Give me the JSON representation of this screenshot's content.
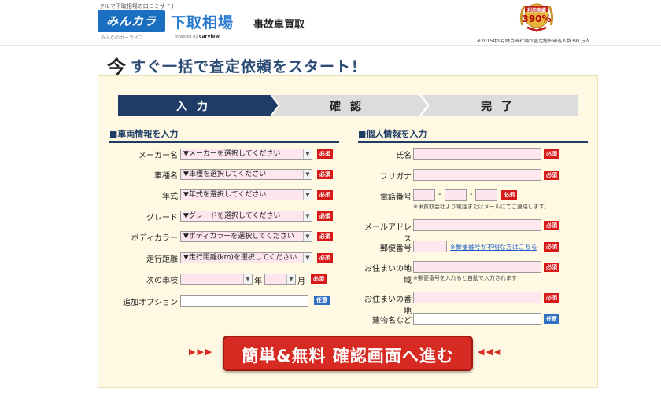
{
  "header": {
    "tagline": "クルマ下取相場の口コミサイト",
    "logo": "みんカラ",
    "logo_sub": "みんなのカーライフ",
    "powered": "powered by",
    "powered_brand": "carview",
    "brand": "下取相場",
    "service": "事故車買取",
    "medal_label": "利用実績",
    "medal_value": "390%",
    "stat_note": "※2015年9月時点当社調べ査定総お申込人数391万人"
  },
  "headline": {
    "icon": "今",
    "text": "すぐ一括で査定依頼をスタート！"
  },
  "steps": {
    "step1": "入力",
    "step2": "確認",
    "step3": "完了"
  },
  "car_section": {
    "title": "■車両情報を入力",
    "fields": {
      "maker": {
        "label": "メーカー名",
        "value": "▼メーカーを選択してください",
        "required": "必須"
      },
      "model": {
        "label": "車種名",
        "value": "▼車種を選択してください",
        "required": "必須"
      },
      "year": {
        "label": "年式",
        "value": "▼年式を選択してください",
        "required": "必須"
      },
      "grade": {
        "label": "グレード",
        "value": "▼グレードを選択してください",
        "required": "必須"
      },
      "color": {
        "label": "ボディカラー",
        "value": "▼ボディカラーを選択してください",
        "required": "必須"
      },
      "mileage": {
        "label": "走行距離",
        "value": "▼走行距離(km)を選択してください",
        "required": "必須"
      },
      "inspection": {
        "label": "次の車検",
        "year_unit": "年",
        "month_unit": "月",
        "required": "必須"
      },
      "options": {
        "label": "追加オプション",
        "optional": "任意"
      }
    }
  },
  "person_section": {
    "title": "■個人情報を入力",
    "fields": {
      "name": {
        "label": "氏名",
        "required": "必須"
      },
      "kana": {
        "label": "フリガナ",
        "required": "必須"
      },
      "phone": {
        "label": "電話番号",
        "sep": "-",
        "required": "必須",
        "note": "※車買取会社より電話またはメールにてご連絡します。"
      },
      "email": {
        "label": "メールアドレス",
        "required": "必須"
      },
      "zip": {
        "label": "郵便番号",
        "link": "※郵便番号が不明な方はこちら",
        "required": "必須"
      },
      "region": {
        "label": "お住まいの地域",
        "required": "必須",
        "note": "※郵便番号を入れると自動で入力されます"
      },
      "address": {
        "label": "お住まいの番地",
        "required": "必須"
      },
      "building": {
        "label": "建物名など",
        "optional": "任意"
      }
    }
  },
  "cta": {
    "label": "簡単&無料 確認画面へ進む",
    "left_arrows": "▶▶▶",
    "right_arrows": "◀◀◀"
  },
  "colors": {
    "accent_red": "#d62a23",
    "navy": "#1e3d64",
    "panel_bg": "#fff9e3"
  }
}
